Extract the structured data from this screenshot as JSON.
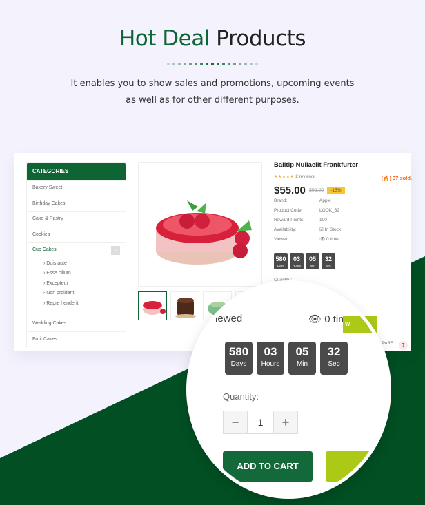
{
  "header": {
    "title_accent": "Hot Deal",
    "title_rest": "Products",
    "subtitle_line1": "It enables you to show sales and promotions, upcoming events",
    "subtitle_line2": "as well as for other different purposes.",
    "dot_count": 17
  },
  "colors": {
    "brand_green": "#0f6434",
    "dark_green_bg": "#024f23",
    "lime": "#acc916",
    "page_bg": "#f3f2fd",
    "sale_orange": "#f0641e",
    "discount_yellow": "#f8c630",
    "countdown_bg": "#4a4a4a"
  },
  "categories": {
    "title": "CATEGORIES",
    "items": [
      {
        "label": "Bakery Sweet"
      },
      {
        "label": "Birthday Cakes"
      },
      {
        "label": "Cake & Pastry"
      },
      {
        "label": "Cookies"
      },
      {
        "label": "Cup Cakes",
        "expanded": true,
        "toggle": "›"
      },
      {
        "label": "Wedding Cakes"
      },
      {
        "label": "Fruit Cakes"
      }
    ],
    "subitems": [
      "› Duis aute",
      "› Esse cillum",
      "› Excepteur",
      "› Non proident",
      "› Repre henderit"
    ]
  },
  "product": {
    "title": "Balltip Nullaelit Frankfurter",
    "stars": "★★★★★",
    "reviews": "2 reviews",
    "sold": "37 sold.",
    "price": "$55.00",
    "old_price": "$65.00",
    "discount": "-15%",
    "specs": [
      {
        "key": "Brand:",
        "value": "Apple"
      },
      {
        "key": "Product Code:",
        "value": "LOOK_32"
      },
      {
        "key": "Reward Points:",
        "value": "100"
      },
      {
        "key": "Availability:",
        "value": "☑ In Stock"
      },
      {
        "key": "Viewed",
        "value": "👁 0 time"
      }
    ],
    "countdown": [
      {
        "value": "580",
        "label": "Days"
      },
      {
        "value": "03",
        "label": "Hours"
      },
      {
        "value": "05",
        "label": "Min"
      },
      {
        "value": "32",
        "label": "Sec"
      }
    ],
    "quantity_label": "Quantity:",
    "quantity": "1",
    "compare": "COMPARE",
    "help": "?"
  },
  "lens": {
    "viewed_label": "iewed",
    "viewed_value": "👁 0 time",
    "buy_partial": "W",
    "minus": "−",
    "plus": "+",
    "add_to_cart": "ADD TO CART"
  }
}
